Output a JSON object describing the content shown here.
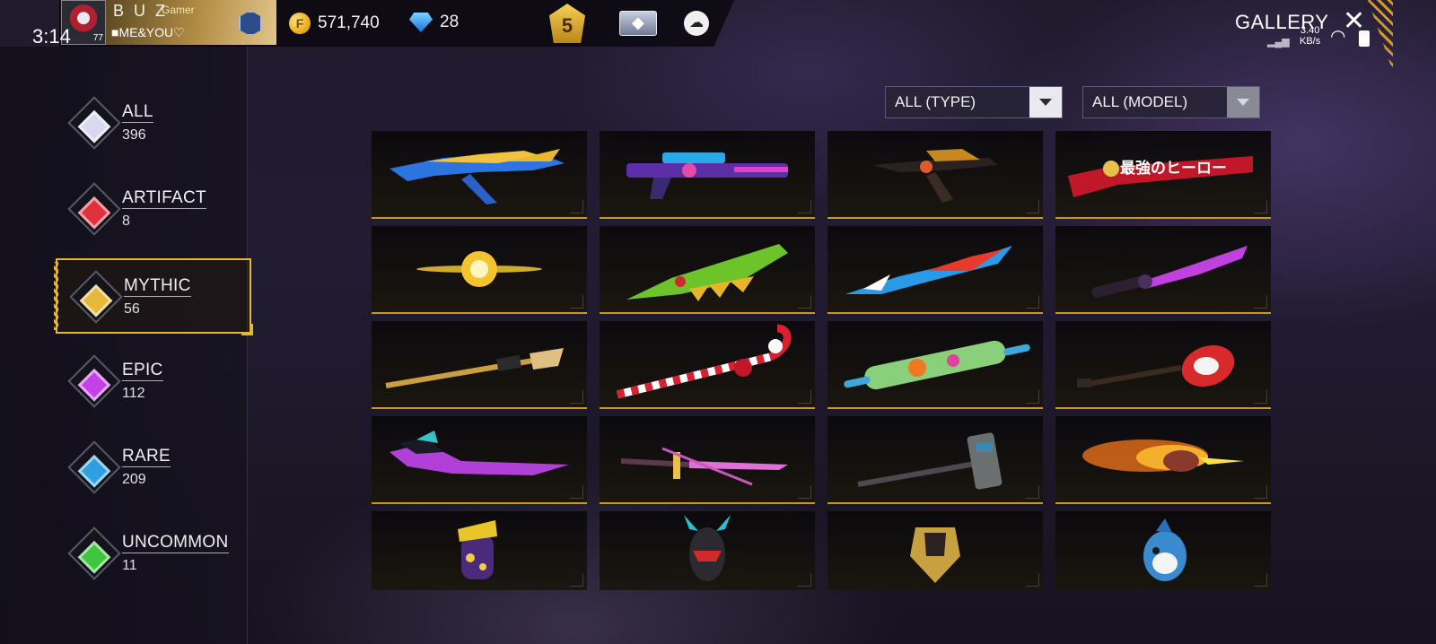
{
  "status_bar": {
    "time": "3:14",
    "net_speed_value": "3.40",
    "net_speed_unit": "KB/s"
  },
  "player": {
    "name": "B U Z",
    "tag": "Gamer",
    "clan": "■ME&YOU♡",
    "level": "77"
  },
  "currency": {
    "gold": "571,740",
    "gold_symbol": "F",
    "diamonds": "28"
  },
  "tier_badge": "5",
  "page_title": "GALLERY",
  "categories": [
    {
      "label": "ALL",
      "count": "396",
      "color": "#d8d8f0"
    },
    {
      "label": "ARTIFACT",
      "count": "8",
      "color": "#e0303c"
    },
    {
      "label": "MYTHIC",
      "count": "56",
      "color": "#e5b93a"
    },
    {
      "label": "EPIC",
      "count": "112",
      "color": "#c640e8"
    },
    {
      "label": "RARE",
      "count": "209",
      "color": "#2f9fe0"
    },
    {
      "label": "UNCOMMON",
      "count": "11",
      "color": "#3ec63e"
    }
  ],
  "selected_category": "MYTHIC",
  "filters": {
    "type": "ALL (TYPE)",
    "model": "ALL (MODEL)"
  },
  "items": [
    {
      "icon": "blue-gold-rifle-icon"
    },
    {
      "icon": "neon-sniper-rifle-icon"
    },
    {
      "icon": "dark-smg-icon"
    },
    {
      "icon": "red-shotgun-icon",
      "text": "最強のヒーロー"
    },
    {
      "icon": "golden-orb-icon"
    },
    {
      "icon": "green-serrated-sword-icon"
    },
    {
      "icon": "blue-red-flame-blade-icon"
    },
    {
      "icon": "purple-katana-icon"
    },
    {
      "icon": "golden-spear-icon"
    },
    {
      "icon": "candy-cane-icon"
    },
    {
      "icon": "rolling-pin-icon"
    },
    {
      "icon": "electric-guitar-icon"
    },
    {
      "icon": "purple-scythe-blade-icon"
    },
    {
      "icon": "pink-katana-icon"
    },
    {
      "icon": "war-hammer-icon"
    },
    {
      "icon": "flaming-fist-icon"
    },
    {
      "icon": "purple-grenade-icon"
    },
    {
      "icon": "red-black-helmet-icon"
    },
    {
      "icon": "gold-armor-icon"
    },
    {
      "icon": "shark-backpack-icon"
    }
  ]
}
